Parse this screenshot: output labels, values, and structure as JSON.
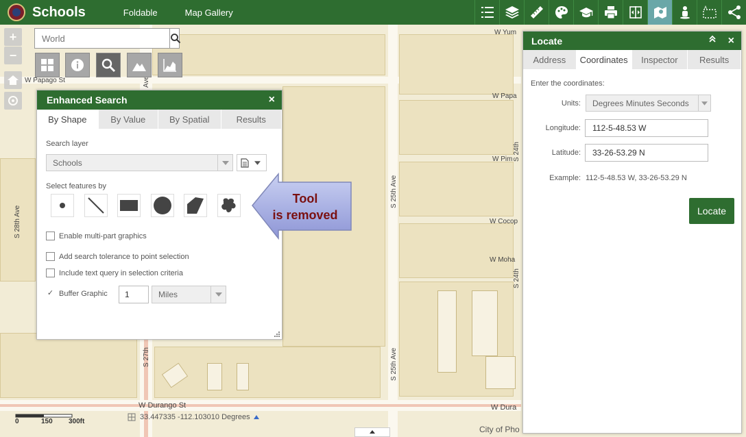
{
  "header": {
    "title": "Schools",
    "links": [
      "Foldable",
      "Map Gallery"
    ]
  },
  "toolbar": {
    "icons": [
      "legend-icon",
      "layers-icon",
      "measure-icon",
      "basemap-gallery-icon",
      "school-icon",
      "print-icon",
      "swipe-icon",
      "locate-icon",
      "street-view-icon",
      "draw-icon",
      "share-icon"
    ],
    "active_index": 7,
    "active_color": "#6aa7a8"
  },
  "search": {
    "placeholder": "World"
  },
  "map_labels": {
    "w_yuma": "W Yum",
    "w_papago": "W Papago St",
    "w_papa": "W Papa",
    "w_pim": "W Pim",
    "w_coco": "W Cocop",
    "w_moha": "W Moha",
    "w_durango": "W Durango St",
    "w_dura": "W Dura",
    "s_28th": "S 28th Ave",
    "s_25th_a": "S 25th Ave",
    "s_25th_b": "S 25th Ave",
    "s_24th_a": "S 24th",
    "s_24th_b": "S 24th",
    "s_27th": "S 27th",
    "ave_frag": "Ave"
  },
  "enhanced_search": {
    "title": "Enhanced Search",
    "close": "×",
    "tabs": [
      "By Shape",
      "By Value",
      "By Spatial",
      "Results"
    ],
    "active_tab": 0,
    "search_layer_label": "Search layer",
    "search_layer_value": "Schools",
    "select_features_label": "Select features by",
    "shapes": [
      "point-icon",
      "line-icon",
      "rectangle-icon",
      "circle-icon",
      "polygon-icon",
      "freehand-icon"
    ],
    "options": [
      {
        "label": "Enable multi-part graphics",
        "checked": false
      },
      {
        "label": "Add search tolerance to point selection",
        "checked": false
      },
      {
        "label": "Include text query in selection criteria",
        "checked": false
      },
      {
        "label": "Buffer Graphic",
        "checked": true
      }
    ],
    "buffer_value": "1",
    "buffer_unit": "Miles"
  },
  "callout": {
    "line1": "Tool",
    "line2": "is removed"
  },
  "locate": {
    "title": "Locate",
    "close": "×",
    "collapse": "⌃",
    "tabs": [
      "Address",
      "Coordinates",
      "Inspector",
      "Results"
    ],
    "active_tab": 1,
    "instruction": "Enter the coordinates:",
    "units_label": "Units:",
    "units_value": "Degrees Minutes Seconds",
    "longitude_label": "Longitude:",
    "longitude_value": "112-5-48.53 W",
    "latitude_label": "Latitude:",
    "latitude_value": "33-26-53.29 N",
    "example_label": "Example:",
    "example_value": "112-5-48.53 W, 33-26-53.29 N",
    "button": "Locate"
  },
  "status": {
    "coordinates": "33.447335  -112.103010 Degrees",
    "scale_labels": [
      "0",
      "150",
      "300ft"
    ],
    "attribution": "City of Pho"
  }
}
